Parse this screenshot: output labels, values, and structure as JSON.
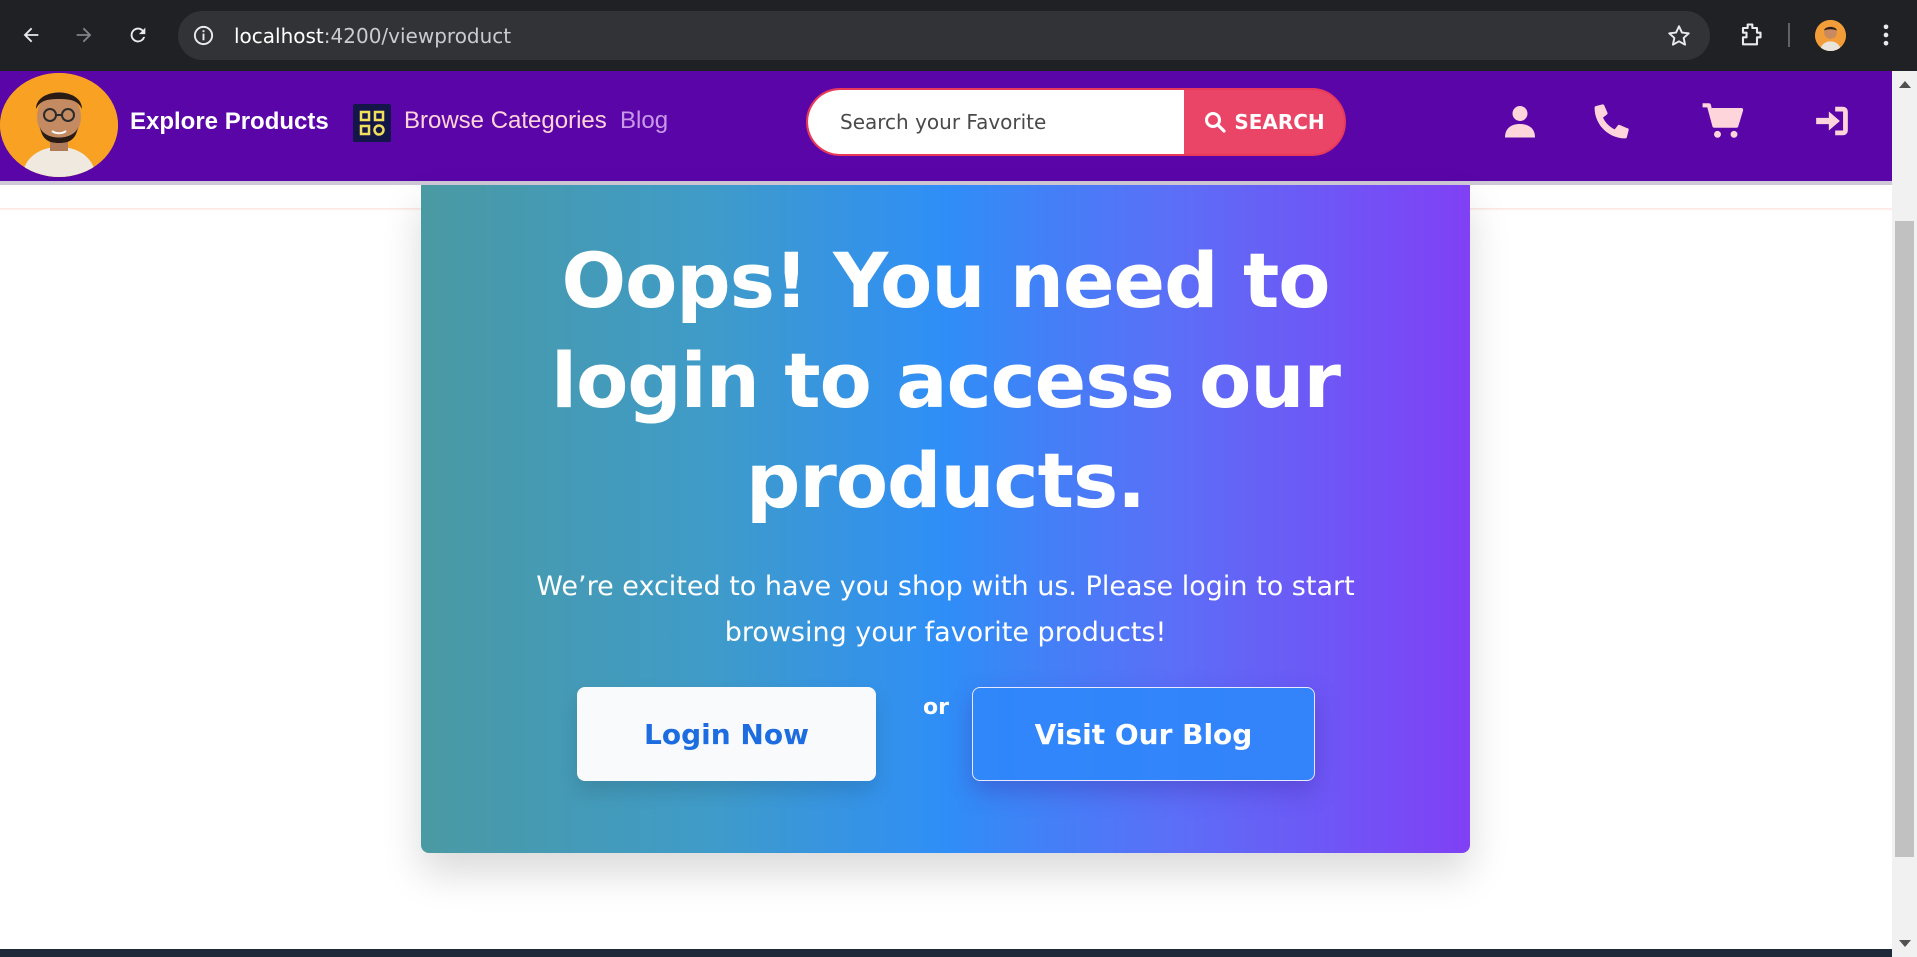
{
  "browser": {
    "url_host": "localhost",
    "url_path": ":4200/viewproduct"
  },
  "navbar": {
    "brand": "Explore Products",
    "categories_label": "Browse Categories",
    "blog_label": "Blog",
    "search_placeholder": "Search your Favorite",
    "search_button": "SEARCH",
    "icons": [
      "user-icon",
      "phone-icon",
      "cart-icon",
      "sign-in-icon"
    ]
  },
  "card": {
    "title": "Oops! You need to login to access our products.",
    "text": "We’re excited to have you shop with us. Please login to start browsing your favorite products!",
    "login_button": "Login Now",
    "or_label": "or",
    "blog_button": "Visit Our Blog"
  },
  "colors": {
    "navbar_bg": "#5a05a8",
    "search_button": "#ea4566",
    "login_text": "#1d6de0",
    "gradient_start": "#4a9aa3",
    "gradient_mid": "#2f8ef7",
    "gradient_end": "#8040f5"
  }
}
